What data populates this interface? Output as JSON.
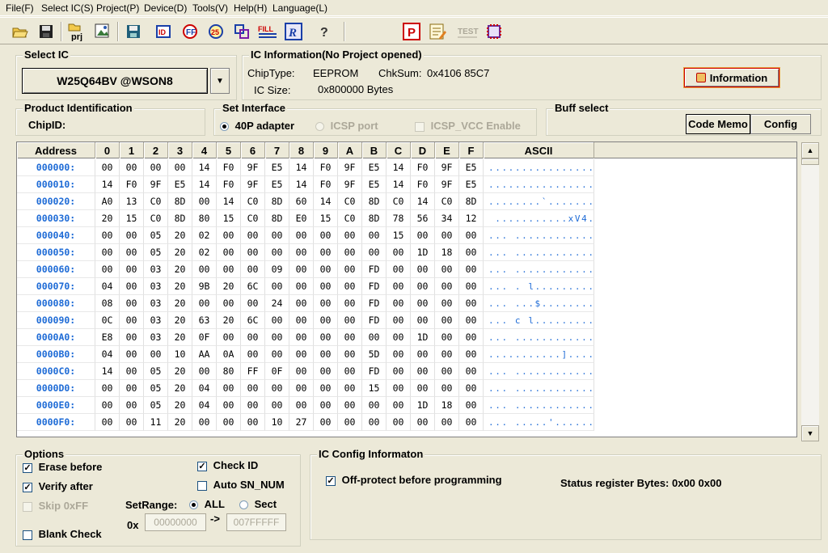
{
  "menu": [
    "File(F)",
    "Select IC(S)",
    "Project(P)",
    "Device(D)",
    "Tools(V)",
    "Help(H)",
    "Language(L)"
  ],
  "toolbar": {
    "prj_label": "prj",
    "fill_label": "FILL",
    "test_label": "TEST",
    "help_glyph": "?"
  },
  "select_ic": {
    "title": "Select IC",
    "value": "W25Q64BV @WSON8"
  },
  "ic_info": {
    "title": "IC Information(No Project opened)",
    "chip_type_label": "ChipType:",
    "chip_type": "EEPROM",
    "chksum_label": "ChkSum:",
    "chksum": "0x4106 85C7",
    "size_label": "IC Size:",
    "size": "0x800000 Bytes",
    "info_button": "Information"
  },
  "product_id": {
    "title": "Product Identification",
    "chip_id_label": "ChipID:"
  },
  "interface": {
    "title": "Set Interface",
    "opt1": "40P adapter",
    "opt2": "ICSP port",
    "opt3": "ICSP_VCC Enable"
  },
  "buff": {
    "title": "Buff select",
    "code_memo": "Code Memo",
    "config": "Config"
  },
  "grid": {
    "headers": [
      "Address",
      "0",
      "1",
      "2",
      "3",
      "4",
      "5",
      "6",
      "7",
      "8",
      "9",
      "A",
      "B",
      "C",
      "D",
      "E",
      "F",
      "ASCII"
    ],
    "rows": [
      {
        "addr": "000000:",
        "bytes": [
          "00",
          "00",
          "00",
          "00",
          "14",
          "F0",
          "9F",
          "E5",
          "14",
          "F0",
          "9F",
          "E5",
          "14",
          "F0",
          "9F",
          "E5"
        ],
        "ascii": "................"
      },
      {
        "addr": "000010:",
        "bytes": [
          "14",
          "F0",
          "9F",
          "E5",
          "14",
          "F0",
          "9F",
          "E5",
          "14",
          "F0",
          "9F",
          "E5",
          "14",
          "F0",
          "9F",
          "E5"
        ],
        "ascii": "................"
      },
      {
        "addr": "000020:",
        "bytes": [
          "A0",
          "13",
          "C0",
          "8D",
          "00",
          "14",
          "C0",
          "8D",
          "60",
          "14",
          "C0",
          "8D",
          "C0",
          "14",
          "C0",
          "8D"
        ],
        "ascii": "........`......."
      },
      {
        "addr": "000030:",
        "bytes": [
          "20",
          "15",
          "C0",
          "8D",
          "80",
          "15",
          "C0",
          "8D",
          "E0",
          "15",
          "C0",
          "8D",
          "78",
          "56",
          "34",
          "12"
        ],
        "ascii": " ...........xV4."
      },
      {
        "addr": "000040:",
        "bytes": [
          "00",
          "00",
          "05",
          "20",
          "02",
          "00",
          "00",
          "00",
          "00",
          "00",
          "00",
          "00",
          "15",
          "00",
          "00",
          "00"
        ],
        "ascii": "... ............"
      },
      {
        "addr": "000050:",
        "bytes": [
          "00",
          "00",
          "05",
          "20",
          "02",
          "00",
          "00",
          "00",
          "00",
          "00",
          "00",
          "00",
          "00",
          "1D",
          "18",
          "00"
        ],
        "ascii": "... ............"
      },
      {
        "addr": "000060:",
        "bytes": [
          "00",
          "00",
          "03",
          "20",
          "00",
          "00",
          "00",
          "09",
          "00",
          "00",
          "00",
          "FD",
          "00",
          "00",
          "00",
          "00"
        ],
        "ascii": "... ............"
      },
      {
        "addr": "000070:",
        "bytes": [
          "04",
          "00",
          "03",
          "20",
          "9B",
          "20",
          "6C",
          "00",
          "00",
          "00",
          "00",
          "FD",
          "00",
          "00",
          "00",
          "00"
        ],
        "ascii": "... . l........."
      },
      {
        "addr": "000080:",
        "bytes": [
          "08",
          "00",
          "03",
          "20",
          "00",
          "00",
          "00",
          "24",
          "00",
          "00",
          "00",
          "FD",
          "00",
          "00",
          "00",
          "00"
        ],
        "ascii": "... ...$........"
      },
      {
        "addr": "000090:",
        "bytes": [
          "0C",
          "00",
          "03",
          "20",
          "63",
          "20",
          "6C",
          "00",
          "00",
          "00",
          "00",
          "FD",
          "00",
          "00",
          "00",
          "00"
        ],
        "ascii": "... c l........."
      },
      {
        "addr": "0000A0:",
        "bytes": [
          "E8",
          "00",
          "03",
          "20",
          "0F",
          "00",
          "00",
          "00",
          "00",
          "00",
          "00",
          "00",
          "00",
          "1D",
          "00",
          "00"
        ],
        "ascii": "... ............"
      },
      {
        "addr": "0000B0:",
        "bytes": [
          "04",
          "00",
          "00",
          "10",
          "AA",
          "0A",
          "00",
          "00",
          "00",
          "00",
          "00",
          "5D",
          "00",
          "00",
          "00",
          "00"
        ],
        "ascii": "...........]...."
      },
      {
        "addr": "0000C0:",
        "bytes": [
          "14",
          "00",
          "05",
          "20",
          "00",
          "80",
          "FF",
          "0F",
          "00",
          "00",
          "00",
          "FD",
          "00",
          "00",
          "00",
          "00"
        ],
        "ascii": "... ............"
      },
      {
        "addr": "0000D0:",
        "bytes": [
          "00",
          "00",
          "05",
          "20",
          "04",
          "00",
          "00",
          "00",
          "00",
          "00",
          "00",
          "15",
          "00",
          "00",
          "00",
          "00"
        ],
        "ascii": "... ............"
      },
      {
        "addr": "0000E0:",
        "bytes": [
          "00",
          "00",
          "05",
          "20",
          "04",
          "00",
          "00",
          "00",
          "00",
          "00",
          "00",
          "00",
          "00",
          "1D",
          "18",
          "00"
        ],
        "ascii": "... ............"
      },
      {
        "addr": "0000F0:",
        "bytes": [
          "00",
          "00",
          "11",
          "20",
          "00",
          "00",
          "00",
          "10",
          "27",
          "00",
          "00",
          "00",
          "00",
          "00",
          "00",
          "00"
        ],
        "ascii": "... .....'......"
      }
    ]
  },
  "options": {
    "title": "Options",
    "erase_before": "Erase before",
    "verify_after": "Verify after",
    "skip_ff": "Skip 0xFF",
    "blank_check": "Blank Check",
    "check_id": "Check ID",
    "auto_sn": "Auto SN_NUM",
    "set_range": "SetRange:",
    "range_all": "ALL",
    "range_sect": "Sect",
    "hex_prefix": "0x",
    "range_start": "00000000",
    "arrow": "->",
    "range_end": "007FFFFF"
  },
  "ic_config": {
    "title": "IC Config Informaton",
    "off_protect": "Off-protect before programming",
    "status": "Status register Bytes: 0x00 0x00"
  },
  "colors": {
    "address": "#1E6BD6",
    "background": "#ECE9D8"
  }
}
